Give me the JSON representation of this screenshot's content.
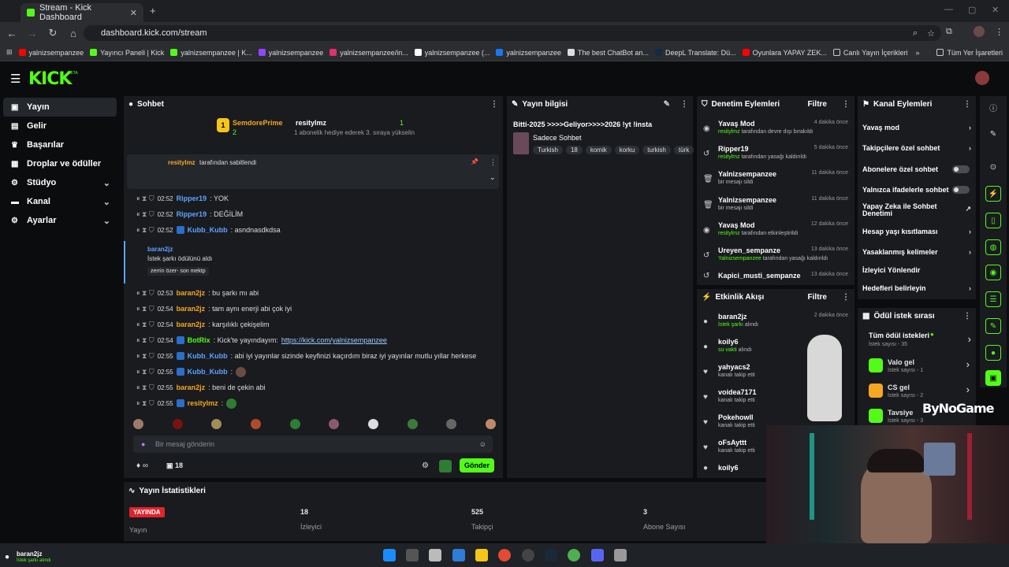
{
  "browser": {
    "tab_title": "Stream - Kick Dashboard",
    "url": "dashboard.kick.com/stream",
    "bookmarks": [
      "yalnizsempanzee",
      "Yayıncı Paneli | Kick",
      "yalnizsempanzee | K...",
      "yalnizsempanzee",
      "yalnizsempanzee/in...",
      "yalnizsempanzee (...",
      "yalnizsempanzee",
      "The best ChatBot an...",
      "DeepL Translate: Dü...",
      "Oyunlara YAPAY ZEK...",
      "Canlı Yayın İçerikleri"
    ],
    "bookmarks_right": "Tüm Yer İşaretleri"
  },
  "kick": {
    "logo": "KICK",
    "beta": "BETA"
  },
  "sidebar": [
    {
      "label": "Yayın",
      "icon": "camera-icon"
    },
    {
      "label": "Gelir",
      "icon": "money-icon"
    },
    {
      "label": "Başarılar",
      "icon": "trophy-icon"
    },
    {
      "label": "Droplar ve ödüller",
      "icon": "gift-icon"
    },
    {
      "label": "Stüdyo",
      "icon": "studio-icon"
    },
    {
      "label": "Kanal",
      "icon": "channel-icon"
    },
    {
      "label": "Ayarlar",
      "icon": "gear-icon"
    }
  ],
  "chat": {
    "title": "Sohbet",
    "top_gifter": {
      "rank": "1",
      "name1": "SemdorePrime",
      "count1": "2",
      "name2": "resitylmz",
      "count2": "1",
      "sub_text": "1 abonelik hediye ederek 3. sıraya yükselin"
    },
    "pinned": {
      "user": "resitylmz",
      "text": "tarafından sabitlendi"
    },
    "messages": [
      {
        "time": "02:52",
        "user": "Ripper19",
        "color": "b",
        "text": ": YOK"
      },
      {
        "time": "02:52",
        "user": "Ripper19",
        "color": "b",
        "text": ": DEĞİLİM"
      },
      {
        "time": "02:52",
        "user": "Kubb_Kubb",
        "color": "b",
        "text": ": asndnasdkdsa"
      }
    ],
    "reward": {
      "user": "baran2jz",
      "text": "İstek şarkı ödülünü aldı",
      "song": "zerrin özer- son mektp"
    },
    "messages2": [
      {
        "time": "02:53",
        "user": "baran2jz",
        "color": "o",
        "text": ": bu şarkı mı abi"
      },
      {
        "time": "02:54",
        "user": "baran2jz",
        "color": "o",
        "text": ": tam aynı enerji abi çok iyi"
      },
      {
        "time": "02:54",
        "user": "baran2jz",
        "color": "o",
        "text": ": karşılıklı çekişelim"
      },
      {
        "time": "02:54",
        "user": "BotRix",
        "color": "g",
        "text": ": Kick'te yayındayım: ",
        "link": "https://kick.com/yalnizsempanzee"
      },
      {
        "time": "02:55",
        "user": "Kubb_Kubb",
        "color": "b",
        "text": ": abi iyi yayınlar sizinde keyfinizi kaçırdım biraz iyi yayınlar mutlu yıllar herkese"
      },
      {
        "time": "02:55",
        "user": "Kubb_Kubb",
        "color": "b",
        "text": ":"
      },
      {
        "time": "02:55",
        "user": "baran2jz",
        "color": "o",
        "text": ": beni de çekin abi"
      },
      {
        "time": "02:55",
        "user": "resitylmz",
        "color": "o",
        "text": ":"
      }
    ],
    "input_placeholder": "Bir mesaj gönderin",
    "viewer_count": "18",
    "infinity": "∞",
    "send": "Gönder"
  },
  "info": {
    "title": "Yayın bilgisi",
    "stream_title": "Bitti-2025 >>>>Geliyor>>>>2026 !yt !insta",
    "category": "Sadece Sohbet",
    "tags": [
      "Turkish",
      "18",
      "komik",
      "korku",
      "turkish",
      "türk"
    ]
  },
  "moderation": {
    "title": "Denetim Eylemleri",
    "filter": "Filtre",
    "rows": [
      {
        "icon": "eye-icon",
        "name": "Yavaş Mod",
        "sub_user": "resitylmz",
        "sub": " tarafından devre dışı bırakıldı",
        "time": "4 dakika önce"
      },
      {
        "icon": "unban-icon",
        "name": "Ripper19",
        "sub_user": "resitylmz",
        "sub": " tarafından yasağı kaldırıldı",
        "time": "5 dakika önce"
      },
      {
        "icon": "trash-icon",
        "name": "Yalnizsempanzee",
        "sub_user": "",
        "sub": "bir mesajı sildi",
        "time": "11 dakika önce"
      },
      {
        "icon": "trash-icon",
        "name": "Yalnizsempanzee",
        "sub_user": "",
        "sub": "bir mesajı sildi",
        "time": "11 dakika önce"
      },
      {
        "icon": "eye-icon",
        "name": "Yavaş Mod",
        "sub_user": "resitylmz",
        "sub": " tarafından etkinleştirildi",
        "time": "12 dakika önce"
      },
      {
        "icon": "unban-icon",
        "name": "Ureyen_sempanze",
        "sub_user": "Yalnizsempanzee",
        "sub": " tarafından yasağı kaldırıldı",
        "time": "13 dakika önce"
      },
      {
        "icon": "unban-icon",
        "name": "Kapici_musti_sempanze",
        "sub_user": "",
        "sub": "",
        "time": "13 dakika önce"
      }
    ]
  },
  "activity": {
    "title": "Etkinlik Akışı",
    "filter": "Filtre",
    "rows": [
      {
        "icon": "user-icon",
        "name": "baran2jz",
        "sub": "İstek şarkı",
        "sub2": " alındı",
        "time": "2 dakika önce"
      },
      {
        "icon": "user-icon",
        "name": "koily6",
        "sub": "su vakti",
        "sub2": " alındı",
        "time": ""
      },
      {
        "icon": "heart-icon",
        "name": "yahyacs2",
        "sub": "",
        "sub2": "kanalı takip etti",
        "time": ""
      },
      {
        "icon": "heart-icon",
        "name": "voidea7171",
        "sub": "",
        "sub2": "kanalı takip etti",
        "time": ""
      },
      {
        "icon": "heart-icon",
        "name": "Pokehowll",
        "sub": "",
        "sub2": "kanalı takip etti",
        "time": ""
      },
      {
        "icon": "heart-icon",
        "name": "oFsAyttt",
        "sub": "",
        "sub2": "kanalı takip etti",
        "time": ""
      },
      {
        "icon": "user-icon",
        "name": "koily6",
        "sub": "",
        "sub2": "",
        "time": ""
      }
    ]
  },
  "channel": {
    "title": "Kanal Eylemleri",
    "rows": [
      {
        "label": "Yavaş mod",
        "ctrl": "arrow"
      },
      {
        "label": "Takipçilere özel sohbet",
        "ctrl": "arrow"
      },
      {
        "label": "Abonelere özel sohbet",
        "ctrl": "toggle"
      },
      {
        "label": "Yalnızca ifadelerle sohbet",
        "ctrl": "toggle"
      },
      {
        "label": "Yapay Zeka ile Sohbet Denetimi",
        "ctrl": "ext"
      },
      {
        "label": "Hesap yaşı kısıtlaması",
        "ctrl": "arrow"
      },
      {
        "label": "Yasaklanmış kelimeler",
        "ctrl": "arrow"
      },
      {
        "label": "İzleyici Yönlendir",
        "ctrl": "none"
      },
      {
        "label": "Hedefleri belirleyin",
        "ctrl": "arrow"
      }
    ]
  },
  "rewards": {
    "title": "Ödül istek sırası",
    "all": "Tüm ödül istekleri",
    "all_sub": "İstek sayısı - 35",
    "items": [
      {
        "name": "Valo gel",
        "sub": "İstek sayısı - 1",
        "color": "#53fc18"
      },
      {
        "name": "CS gel",
        "sub": "İstek sayısı - 2",
        "color": "#f5a623"
      },
      {
        "name": "Tavsiye",
        "sub": "İstek sayısı - 3",
        "color": "#53fc18"
      }
    ]
  },
  "watermark": "ByNoGame",
  "stats": {
    "title": "Yayın İstatistikleri",
    "live": "YAYINDA",
    "live_label": "Yayın",
    "items": [
      {
        "value": "18",
        "label": "İzleyici"
      },
      {
        "value": "525",
        "label": "Takipçi"
      },
      {
        "value": "3",
        "label": "Abone Sayısı"
      }
    ]
  },
  "bottom_user": {
    "name": "baran2jz",
    "sub": "İstek şarkı alındı"
  }
}
